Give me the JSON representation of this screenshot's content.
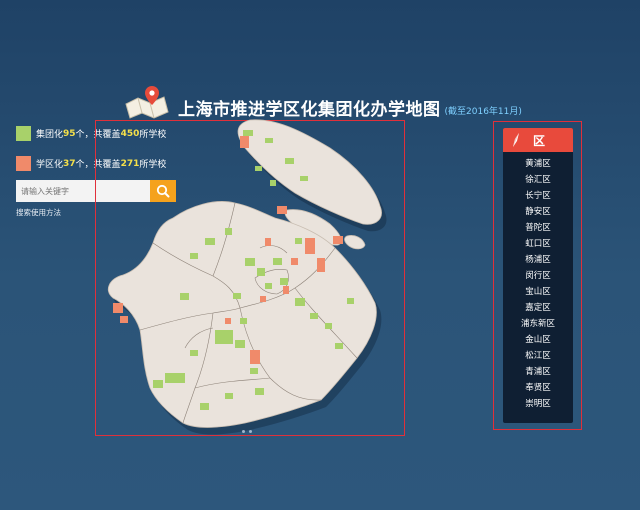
{
  "header": {
    "title": "上海市推进学区化集团化办学地图",
    "subtitle": "(截至2016年11月)"
  },
  "legend": {
    "group": {
      "prefix": "集团化",
      "count": "95",
      "mid": "个，共覆盖",
      "schools": "450",
      "suffix": "所学校",
      "color": "#a8d16a"
    },
    "district": {
      "prefix": "学区化",
      "count": "37",
      "mid": "个，共覆盖",
      "schools": "271",
      "suffix": "所学校",
      "color": "#f08a6a"
    }
  },
  "search": {
    "placeholder": "请输入关键字",
    "icon": "search-icon",
    "help": "搜索使用方法"
  },
  "panel": {
    "header": "区",
    "icon": "compass-icon",
    "districts": [
      "黄浦区",
      "徐汇区",
      "长宁区",
      "静安区",
      "普陀区",
      "虹口区",
      "杨浦区",
      "闵行区",
      "宝山区",
      "嘉定区",
      "浦东新区",
      "金山区",
      "松江区",
      "青浦区",
      "奉贤区",
      "崇明区"
    ]
  },
  "colors": {
    "accent_red": "#e84a3c",
    "land": "#eae3dc",
    "group_green": "#a8d16a",
    "district_orange": "#f08a6a",
    "search_orange": "#f5a21d"
  }
}
